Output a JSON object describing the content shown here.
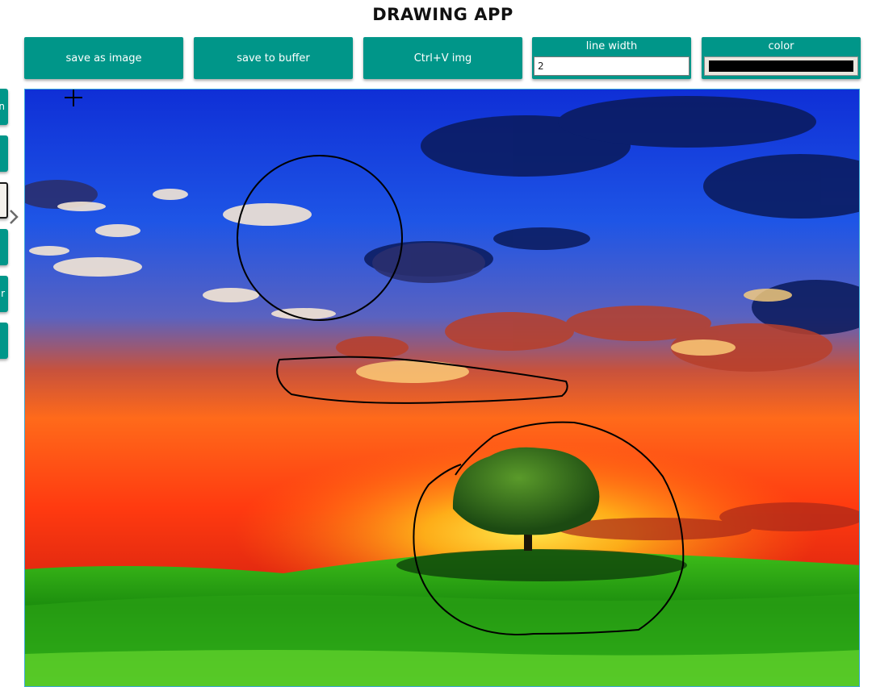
{
  "app": {
    "title": "DRAWING APP"
  },
  "toolbar": {
    "save_image_label": "save as image",
    "save_buffer_label": "save to buffer",
    "paste_label": "Ctrl+V img",
    "line_width": {
      "label": "line width",
      "value": "2"
    },
    "color": {
      "label": "color",
      "value": "#000000"
    }
  },
  "sidebar": {
    "tabs": [
      {
        "label": "n",
        "active": false
      },
      {
        "label": "",
        "active": false
      },
      {
        "label": "",
        "active": true
      },
      {
        "label": "",
        "active": false
      },
      {
        "label": "r",
        "active": false
      },
      {
        "label": "",
        "active": false
      }
    ],
    "expand_icon": "chevron-right-icon"
  },
  "canvas": {
    "background_image": "sunset-tree-landscape",
    "cursor_icon": "crosshair-icon"
  },
  "colors": {
    "accent": "#009689",
    "canvas_border": "#3ca9d8"
  }
}
